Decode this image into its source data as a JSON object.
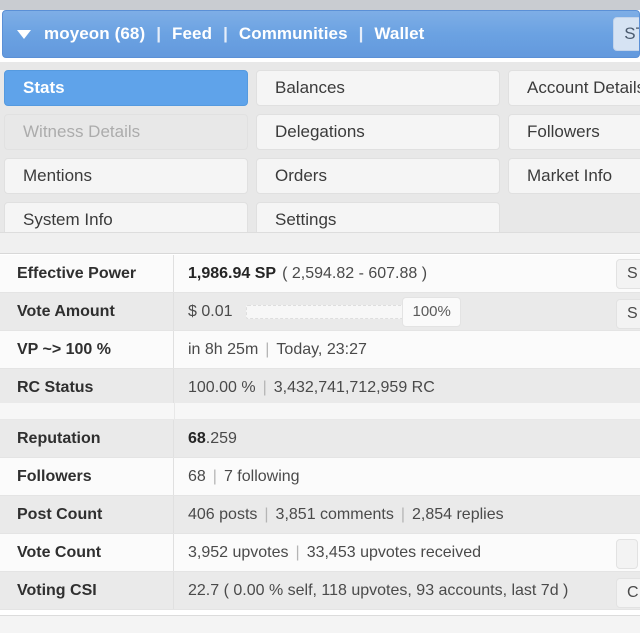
{
  "navbar": {
    "caret_icon": "chevron-down-icon",
    "account": "moyeon (68)",
    "separator": "|",
    "links": [
      "Feed",
      "Communities",
      "Wallet"
    ],
    "right_button": "ST",
    "bg_color": "#6ba2e2",
    "text_color": "#ffffff"
  },
  "tabs": {
    "active_color": "#5fa3ea",
    "rows": [
      [
        {
          "label": "Stats",
          "state": "active"
        },
        {
          "label": "Balances",
          "state": "normal"
        },
        {
          "label": "Account Details",
          "state": "normal"
        }
      ],
      [
        {
          "label": "Witness Details",
          "state": "disabled"
        },
        {
          "label": "Delegations",
          "state": "normal"
        },
        {
          "label": "Followers",
          "state": "normal"
        }
      ],
      [
        {
          "label": "Mentions",
          "state": "normal"
        },
        {
          "label": "Orders",
          "state": "normal"
        },
        {
          "label": "Market Info",
          "state": "normal"
        }
      ],
      [
        {
          "label": "System Info",
          "state": "normal"
        },
        {
          "label": "Settings",
          "state": "normal"
        },
        {
          "label": "",
          "state": "empty"
        }
      ]
    ]
  },
  "stats": {
    "section1": [
      {
        "label": "Effective Power",
        "value_strong": "1,986.94 SP",
        "value_rest": "( 2,594.82 - 607.88 )",
        "action_button": "S"
      },
      {
        "label": "Vote Amount",
        "value_strong": "$ 0.01",
        "value_rest": "",
        "slider_percent": "100%",
        "action_button": "S"
      },
      {
        "label": "VP ~> 100 %",
        "value_strong": "",
        "value_rest": "in 8h 25m",
        "value_tail": "Today, 23:27"
      },
      {
        "label": "RC Status",
        "value_strong": "",
        "value_rest": "100.00 %",
        "value_tail": "3,432,741,712,959 RC"
      }
    ],
    "section2": [
      {
        "label": "Reputation",
        "value_strong": "68",
        "value_rest": ".259"
      },
      {
        "label": "Followers",
        "value_strong": "",
        "value_rest": "68",
        "value_tail": "7 following"
      },
      {
        "label": "Post Count",
        "value_strong": "",
        "value_rest": "406 posts",
        "value_tail": "3,851 comments",
        "value_tail2": "2,854 replies"
      },
      {
        "label": "Vote Count",
        "value_strong": "",
        "value_rest": "3,952 upvotes",
        "value_tail": "33,453 upvotes received",
        "action_button": ""
      },
      {
        "label": "Voting CSI",
        "value_strong": "",
        "value_rest": "22.7 ( 0.00 % self, 118 upvotes, 93 accounts, last 7d )",
        "action_button": "C"
      }
    ]
  }
}
